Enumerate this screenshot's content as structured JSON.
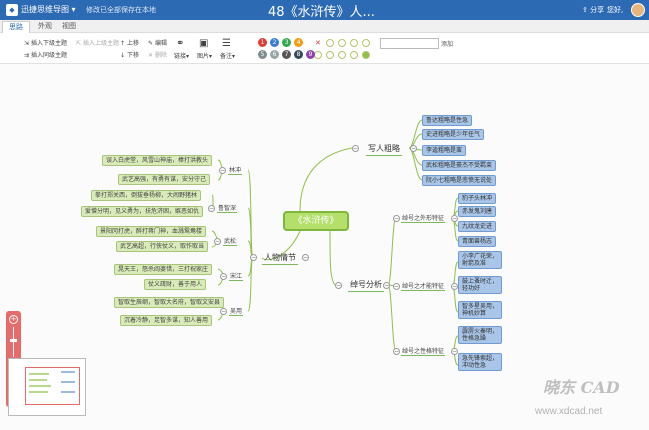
{
  "header": {
    "app_name": "迅捷思维导图",
    "save_status": "修改已全部保存在本地",
    "doc_title": "48《水浒传》人...",
    "share": "分享",
    "greeting": "您好,"
  },
  "tabs": [
    "思路",
    "外观",
    "视图"
  ],
  "toolbar": {
    "insert_sub": "插入下级主题",
    "insert_parent": "插入上级主题",
    "insert_sibling": "插入同级主题",
    "move_up": "上移",
    "move_down": "下移",
    "edit": "编辑",
    "delete": "删除",
    "link": "链接",
    "image": "图片",
    "note": "备注",
    "search_button": "添加",
    "priority_numbers": [
      "1",
      "2",
      "3",
      "4",
      "5",
      "6",
      "7",
      "8",
      "9"
    ],
    "priority_colors": [
      "#e03c31",
      "#3a7bd5",
      "#2fa84f",
      "#f39c12",
      "#7f8c8d",
      "#95a5a6",
      "#555555",
      "#34495e",
      "#8e44ad"
    ]
  },
  "mindmap": {
    "root": "《水浒传》",
    "branches": {
      "left_main": "人物情节",
      "right_top": "写人粗略",
      "right_bottom": "绰号分析"
    },
    "left_subs": [
      {
        "name": "林冲",
        "leaves": [
          "误入白虎堂，风雪山神庙，棒打洪教头",
          "武艺高强，有勇有谋，安分守己"
        ]
      },
      {
        "name": "鲁智深",
        "leaves": [
          "拳打郑关西，倒拔垂杨柳，大闹野猪林",
          "爱憎分明，见义勇为，扶危济困，嫉恶如仇"
        ]
      },
      {
        "name": "武松",
        "leaves": [
          "景阳冈打虎，醉打蒋门神，血溅鸳鸯楼",
          "武艺高超，行侠仗义，取作取当"
        ]
      },
      {
        "name": "宋江",
        "leaves": [
          "晁天王，怒杀阎婆惜，三打祝家庄",
          "仗义疏财，善于用人"
        ]
      },
      {
        "name": "吴用",
        "leaves": [
          "智取生辰纲，智取大名府，智取文安县",
          "沉着冷静，足智多谋，知人善用"
        ]
      }
    ],
    "right_top_leaves": [
      "鲁达粗略是性急",
      "史进粗略是少年任气",
      "李逵粗略是蛮",
      "武松粗略是豪杰不受羁束",
      "阮小七粗略是悲愤无说处"
    ],
    "right_bottom_subs": [
      {
        "name": "绰号之外形特征",
        "leaves": [
          "豹子头林冲",
          "赤发鬼刘唐",
          "九纹龙史进",
          "青面兽杨志"
        ]
      },
      {
        "name": "绰号之才能特征",
        "leaves": [
          "小李广花荣，射箭及准",
          "鼓上蚤时迁，轻功好",
          "智多星吴用，神机妙算"
        ]
      },
      {
        "name": "绰号之性格特征",
        "leaves": [
          "霹雳火秦明，性格急躁",
          "急先锋索超，冲动性急"
        ]
      }
    ]
  },
  "watermark": {
    "text": "晓东 CAD",
    "url": "www.xdcad.net"
  }
}
